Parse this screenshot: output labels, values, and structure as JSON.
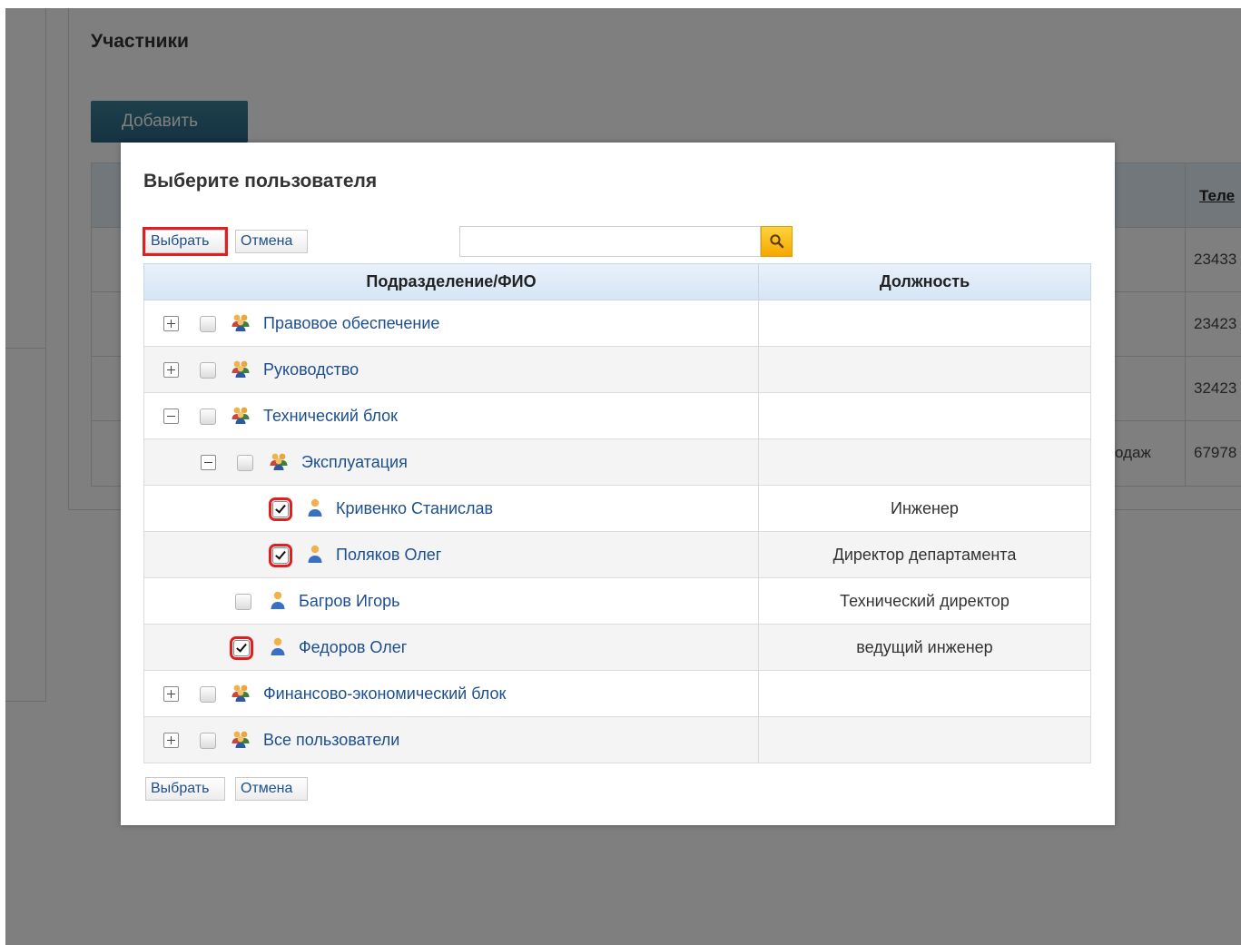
{
  "background": {
    "section_title": "Участники",
    "add_button_label": "Добавить",
    "table_header_fragment": "Теле",
    "rows": [
      {
        "dept_fragment": "",
        "phone_fragment": "23433"
      },
      {
        "dept_fragment": "",
        "phone_fragment": "23423"
      },
      {
        "dept_fragment": "",
        "phone_fragment": "32423"
      },
      {
        "dept_fragment": "одаж",
        "phone_fragment": "67978"
      }
    ]
  },
  "dialog": {
    "title": "Выберите пользователя",
    "select_label": "Выбрать",
    "cancel_label": "Отмена",
    "search": {
      "value": "",
      "placeholder": ""
    },
    "columns": {
      "name": "Подразделение/ФИО",
      "position": "Должность"
    },
    "rows": [
      {
        "type": "group",
        "name": "Правовое обеспечение",
        "position": "",
        "expanded": false,
        "checked": false
      },
      {
        "type": "group",
        "name": "Руководство",
        "position": "",
        "expanded": false,
        "checked": false
      },
      {
        "type": "group",
        "name": "Технический блок",
        "position": "",
        "expanded": true,
        "checked": false
      },
      {
        "type": "group",
        "name": "Эксплуатация",
        "position": "",
        "expanded": true,
        "checked": false
      },
      {
        "type": "user",
        "name": "Кривенко Станислав",
        "position": "Инженер",
        "checked": true
      },
      {
        "type": "user",
        "name": "Поляков Олег",
        "position": "Директор департамента",
        "checked": true
      },
      {
        "type": "user",
        "name": "Багров Игорь",
        "position": "Технический директор",
        "checked": false
      },
      {
        "type": "user",
        "name": "Федоров Олег",
        "position": "ведущий инженер",
        "checked": true
      },
      {
        "type": "group",
        "name": "Финансово-экономический блок",
        "position": "",
        "expanded": false,
        "checked": false
      },
      {
        "type": "group",
        "name": "Все пользователи",
        "position": "",
        "expanded": false,
        "checked": false
      }
    ]
  },
  "colors": {
    "accent_blue": "#1d4f8f",
    "header_blue": "#e4eef7",
    "search_yellow": "#f5a800",
    "highlight_red": "#e02020",
    "overlay": "rgba(0,0,0,0.5)"
  },
  "icons": {
    "group": "group-users-icon",
    "user": "user-icon",
    "search": "search-icon"
  }
}
